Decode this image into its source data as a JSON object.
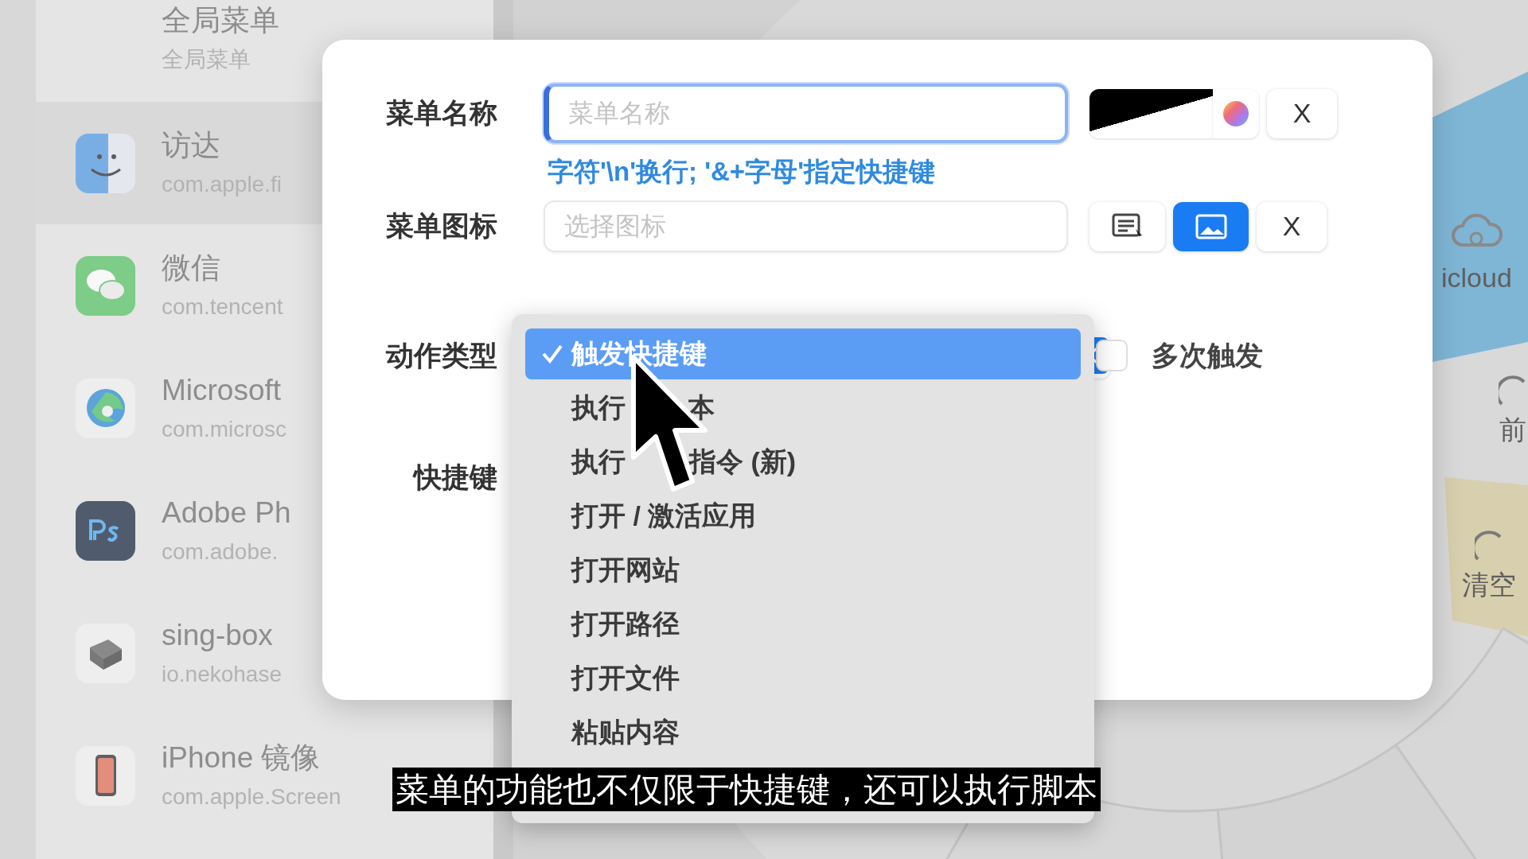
{
  "sidebar": {
    "items": [
      {
        "title": "全局菜单",
        "subtitle": "全局菜单",
        "kind": "none",
        "selected": false
      },
      {
        "title": "访达",
        "subtitle": "com.apple.fi",
        "kind": "finder",
        "selected": true
      },
      {
        "title": "微信",
        "subtitle": "com.tencent",
        "kind": "chat",
        "selected": false
      },
      {
        "title": "Microsoft",
        "subtitle": "com.microsc",
        "kind": "browser",
        "selected": false
      },
      {
        "title": "Adobe Ph",
        "subtitle": "com.adobe.",
        "kind": "ps",
        "selected": false
      },
      {
        "title": "sing-box",
        "subtitle": "io.nekohase",
        "kind": "box",
        "selected": false
      },
      {
        "title": "iPhone 镜像",
        "subtitle": "com.apple.Screen",
        "kind": "phone",
        "selected": false
      }
    ]
  },
  "pie_menu": {
    "labels": [
      {
        "kind": "cloud",
        "text": "icloud"
      },
      {
        "kind": "arc",
        "text": "前"
      },
      {
        "kind": "arc",
        "text": "清空"
      }
    ]
  },
  "dialog": {
    "name_row": {
      "label": "菜单名称",
      "placeholder": "菜单名称",
      "focused": true,
      "hint": "字符'\\n'换行; '&+字母'指定快捷键",
      "clear": "X"
    },
    "icon_row": {
      "label": "菜单图标",
      "placeholder": "选择图标",
      "buttons": [
        {
          "kind": "text-picker",
          "selected": false
        },
        {
          "kind": "image",
          "selected": true
        }
      ],
      "clear": "X"
    },
    "action_row": {
      "label": "动作类型",
      "multi_trigger": {
        "label": "多次触发",
        "checked": false
      }
    },
    "shortcut_row": {
      "label": "快捷键"
    }
  },
  "dropdown": {
    "items": [
      {
        "label": "触发快捷键",
        "selected": true
      },
      {
        "label": "执行",
        "tail": "本",
        "selected": false
      },
      {
        "label": "执行",
        "tail": "指令 (新)",
        "selected": false
      },
      {
        "label": "打开 / 激活应用",
        "selected": false
      },
      {
        "label": "打开网站",
        "selected": false
      },
      {
        "label": "打开路径",
        "selected": false
      },
      {
        "label": "打开文件",
        "selected": false
      },
      {
        "label": "粘贴内容",
        "selected": false
      }
    ]
  },
  "subtitle": "菜单的功能也不仅限于快捷键，还可以执行脚本"
}
